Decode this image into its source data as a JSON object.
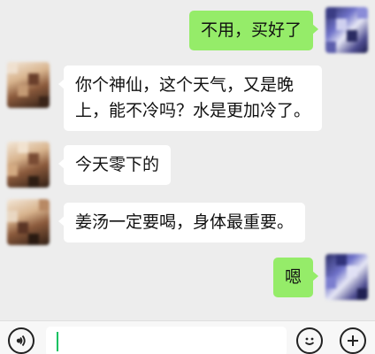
{
  "conversation": {
    "messages": [
      {
        "sender": "me",
        "text": "不用，买好了"
      },
      {
        "sender": "friend",
        "lines": [
          "你个神仙，这个天气，又是晚",
          "上，能不冷吗？水是更加冷了。"
        ]
      },
      {
        "sender": "friend",
        "text": "今天零下的"
      },
      {
        "sender": "friend",
        "text": "姜汤一定要喝，身体最重要。"
      },
      {
        "sender": "me",
        "text": "嗯"
      }
    ]
  },
  "input_bar": {
    "voice_icon": "voice-icon",
    "emoji_icon": "emoji-icon",
    "plus_icon": "plus-icon",
    "message_value": ""
  },
  "colors": {
    "background": "#ededed",
    "incoming_bubble": "#ffffff",
    "outgoing_bubble": "#95ec69",
    "caret": "#07c160"
  }
}
